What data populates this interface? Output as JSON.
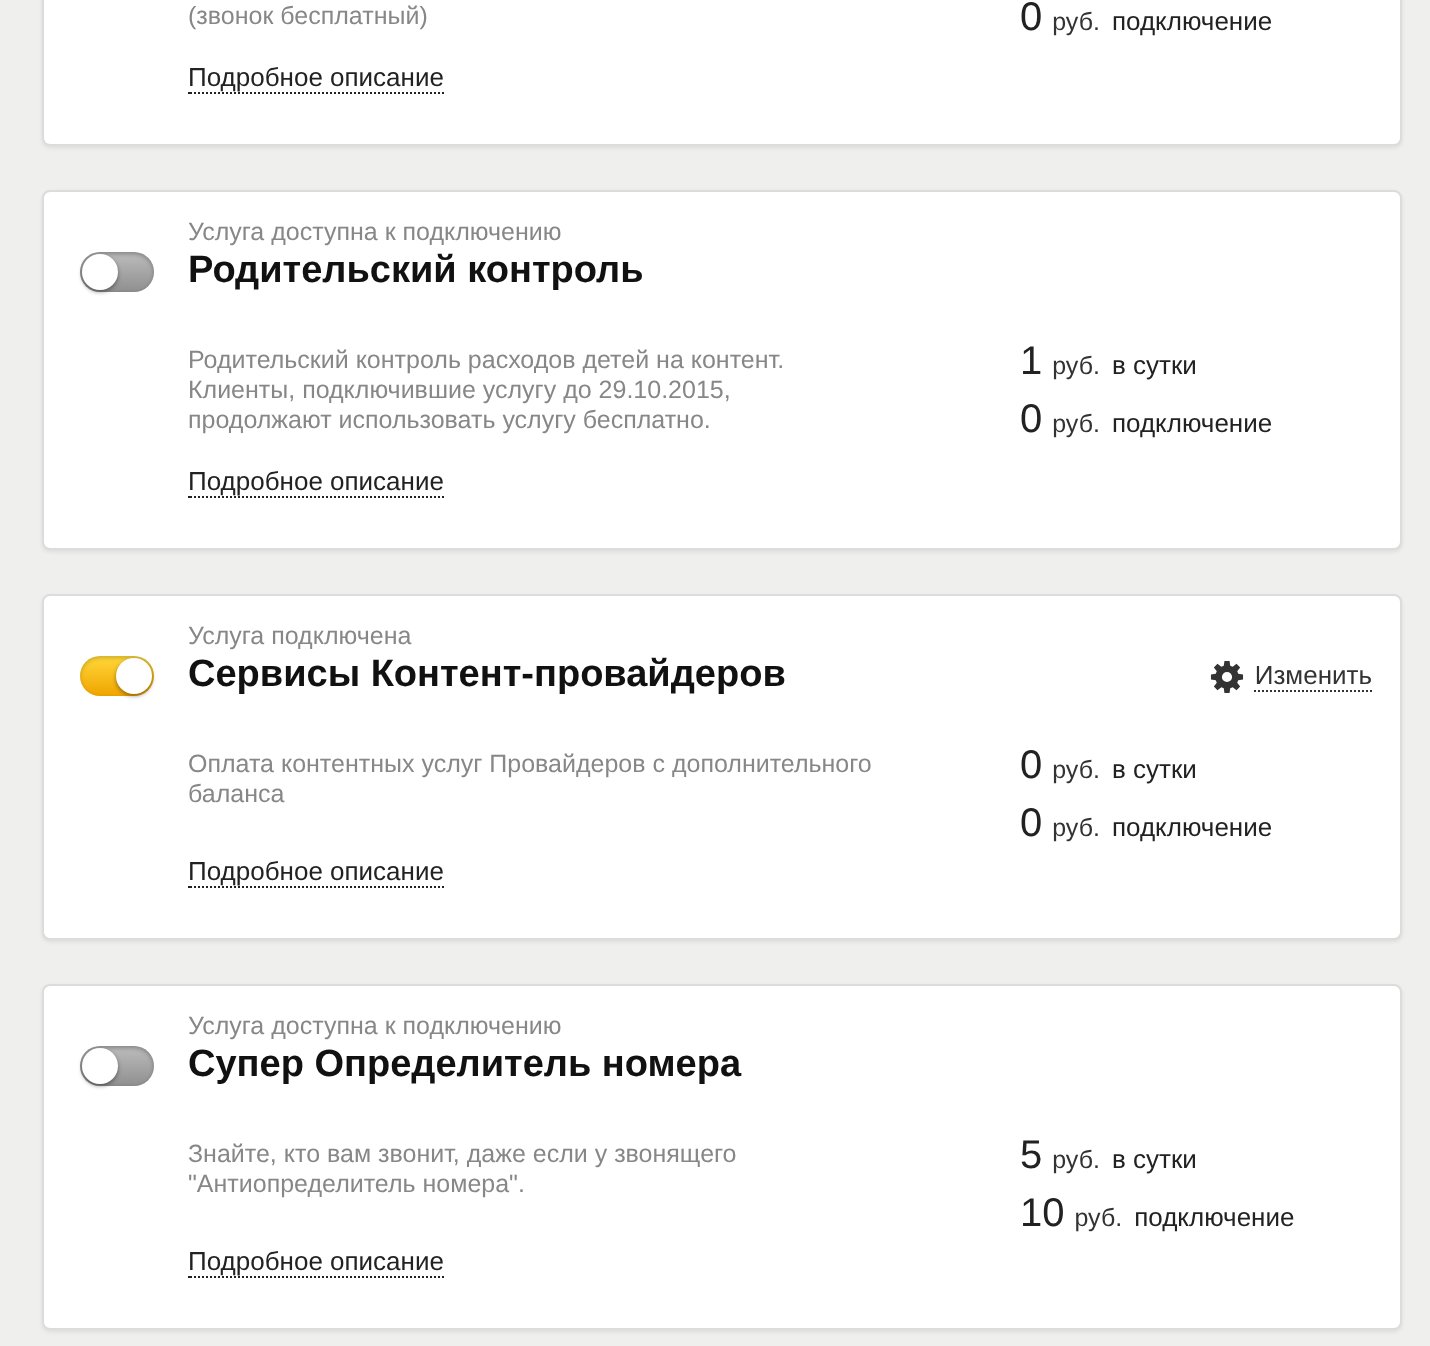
{
  "services": [
    {
      "description": "(звонок бесплатный)",
      "prices": [
        {
          "amount": "0",
          "currency": "руб.",
          "period": "подключение"
        }
      ],
      "details_link": "Подробное описание"
    },
    {
      "status": "Услуга доступна к подключению",
      "title": "Родительский контроль",
      "toggle": {
        "on": false
      },
      "description": "Родительский контроль расходов детей на контент.\nКлиенты, подключившие услугу до 29.10.2015,\nпродолжают использовать услугу бесплатно.",
      "prices": [
        {
          "amount": "1",
          "currency": "руб.",
          "period": "в сутки"
        },
        {
          "amount": "0",
          "currency": "руб.",
          "period": "подключение"
        }
      ],
      "details_link": "Подробное описание"
    },
    {
      "status": "Услуга подключена",
      "title": "Сервисы Контент-провайдеров",
      "toggle": {
        "on": true
      },
      "action": "Изменить",
      "description": "Оплата контентных услуг Провайдеров с дополнительного\nбаланса",
      "prices": [
        {
          "amount": "0",
          "currency": "руб.",
          "period": "в сутки"
        },
        {
          "amount": "0",
          "currency": "руб.",
          "period": "подключение"
        }
      ],
      "details_link": "Подробное описание"
    },
    {
      "status": "Услуга доступна к подключению",
      "title": "Супер Определитель номера",
      "toggle": {
        "on": false
      },
      "description": "Знайте, кто вам звонит, даже если у звонящего\n\"Антиопределитель номера\".",
      "prices": [
        {
          "amount": "5",
          "currency": "руб.",
          "period": "в сутки"
        },
        {
          "amount": "10",
          "currency": "руб.",
          "period": "подключение"
        }
      ],
      "details_link": "Подробное описание"
    }
  ]
}
